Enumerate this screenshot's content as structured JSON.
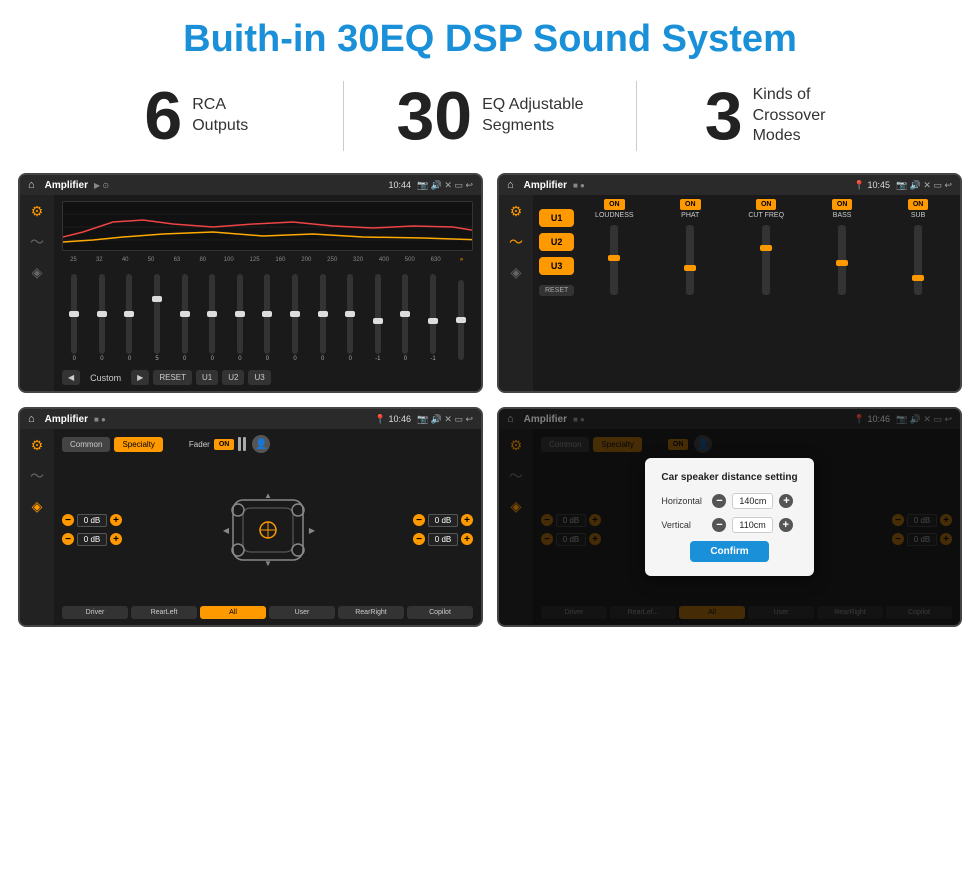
{
  "page": {
    "title": "Buith-in 30EQ DSP Sound System"
  },
  "stats": [
    {
      "number": "6",
      "label": "RCA\nOutputs"
    },
    {
      "number": "30",
      "label": "EQ Adjustable\nSegments"
    },
    {
      "number": "3",
      "label": "Kinds of\nCrossover Modes"
    }
  ],
  "screens": [
    {
      "id": "eq-screen",
      "status_bar": {
        "app": "Amplifier",
        "icons": "▶ ⊙",
        "time": "10:44"
      },
      "type": "eq"
    },
    {
      "id": "crossover-screen",
      "status_bar": {
        "app": "Amplifier",
        "icons": "■ ●",
        "time": "10:45"
      },
      "type": "crossover"
    },
    {
      "id": "fader-screen",
      "status_bar": {
        "app": "Amplifier",
        "icons": "■ ●",
        "time": "10:46"
      },
      "type": "fader"
    },
    {
      "id": "dialog-screen",
      "status_bar": {
        "app": "Amplifier",
        "icons": "■ ●",
        "time": "10:46"
      },
      "type": "dialog"
    }
  ],
  "eq": {
    "frequencies": [
      "25",
      "32",
      "40",
      "50",
      "63",
      "80",
      "100",
      "125",
      "160",
      "200",
      "250",
      "320",
      "400",
      "500",
      "630"
    ],
    "values": [
      "0",
      "0",
      "0",
      "5",
      "0",
      "0",
      "0",
      "0",
      "0",
      "0",
      "0",
      "-1",
      "0",
      "-1",
      ""
    ],
    "preset": "Custom",
    "buttons": [
      "◀",
      "▶",
      "RESET",
      "U1",
      "U2",
      "U3"
    ]
  },
  "crossover": {
    "u_buttons": [
      "U1",
      "U2",
      "U3"
    ],
    "channels": [
      {
        "label": "LOUDNESS",
        "on": true
      },
      {
        "label": "PHAT",
        "on": true
      },
      {
        "label": "CUT FREQ",
        "on": true
      },
      {
        "label": "BASS",
        "on": true
      },
      {
        "label": "SUB",
        "on": true
      }
    ],
    "reset_label": "RESET"
  },
  "fader": {
    "tabs": [
      "Common",
      "Specialty"
    ],
    "fader_label": "Fader",
    "on_label": "ON",
    "volumes": [
      {
        "label": "",
        "value": "0 dB"
      },
      {
        "label": "",
        "value": "0 dB"
      },
      {
        "label": "",
        "value": "0 dB"
      },
      {
        "label": "",
        "value": "0 dB"
      }
    ],
    "bottom_buttons": [
      "Driver",
      "RearLeft",
      "All",
      "User",
      "RearRight",
      "Copilot"
    ]
  },
  "dialog": {
    "title": "Car speaker distance setting",
    "horizontal_label": "Horizontal",
    "horizontal_value": "140cm",
    "vertical_label": "Vertical",
    "vertical_value": "110cm",
    "confirm_label": "Confirm",
    "tabs": [
      "Common",
      "Specialty"
    ],
    "on_label": "ON",
    "bottom_buttons": [
      "Driver",
      "RearLef...",
      "All",
      "User",
      "RearRight",
      "Copilot"
    ]
  },
  "colors": {
    "accent": "#1a90d9",
    "orange": "#f90",
    "dark_bg": "#1a1a1a",
    "panel_bg": "#222"
  }
}
